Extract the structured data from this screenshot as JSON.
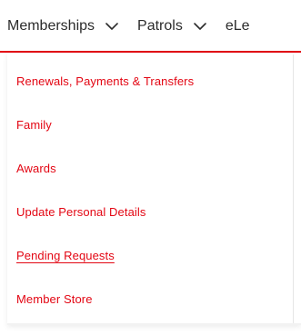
{
  "nav": {
    "items": [
      {
        "label": "Memberships",
        "icon": "chevron-down-icon"
      },
      {
        "label": "Patrols",
        "icon": "chevron-down-icon"
      },
      {
        "label": "eLe"
      }
    ],
    "accent_color": "#e30613"
  },
  "dropdown": {
    "items": [
      {
        "label": "Renewals, Payments & Transfers"
      },
      {
        "label": "Family"
      },
      {
        "label": "Awards"
      },
      {
        "label": "Update Personal Details"
      },
      {
        "label": "Pending Requests"
      },
      {
        "label": "Member Store"
      }
    ]
  }
}
